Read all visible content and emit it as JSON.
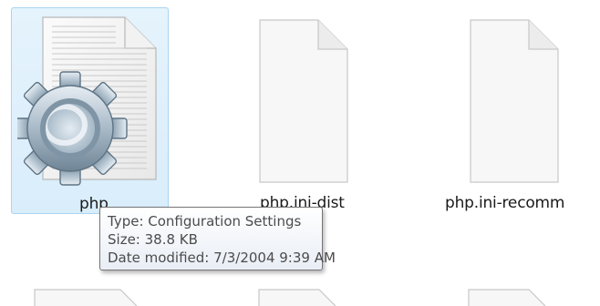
{
  "files": [
    {
      "name": "php",
      "icon": "config-settings-gear-file-icon",
      "selected": true
    },
    {
      "name": "php.ini-dist",
      "icon": "blank-document-icon",
      "selected": false
    },
    {
      "name": "php.ini-recomm",
      "icon": "blank-document-icon",
      "selected": false
    }
  ],
  "tooltip": {
    "type": "Type: Configuration Settings",
    "size": "Size: 38.8 KB",
    "date_modified": "Date modified: 7/3/2004 9:39 AM"
  },
  "colors": {
    "selection_bg": "#dcedfb",
    "selection_border": "#a9d4f0",
    "tooltip_border": "#767676",
    "tooltip_text": "#4c4c4c"
  }
}
